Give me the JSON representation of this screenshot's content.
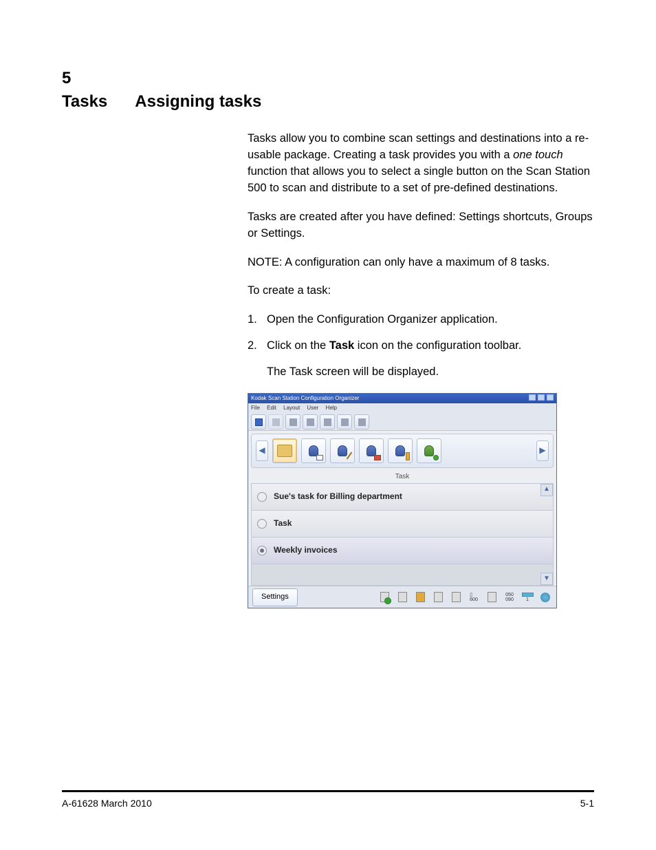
{
  "section": {
    "number": "5",
    "title_left": "Tasks",
    "title_right": "Assigning tasks"
  },
  "body": {
    "p1_a": "Tasks allow you to combine scan settings and destinations into a re-usable package. Creating a task provides you with a",
    "p1_em": "one touch",
    "p1_b": "function that allows you to select a single button on the Scan Station 500 to scan and distribute to a set of pre-defined destinations.",
    "p2": "Tasks are created after you have defined: Settings shortcuts, Groups or Settings.",
    "note_label": "NOTE:",
    "note_text": "A configuration can only have a maximum of 8 tasks.",
    "steps_heading": "To create a task:",
    "step1_num": "1.",
    "step1": "Open the Configuration Organizer application.",
    "step2_num": "2.",
    "step2_a": "Click on the",
    "step2_b": "Task",
    "step2_c": "icon on the configuration toolbar.",
    "sub_result": "The Task screen will be displayed."
  },
  "screenshot": {
    "title": "Kodak Scan Station Configuration Organizer",
    "menu": {
      "file": "File",
      "edit": "Edit",
      "layout": "Layout",
      "user": "User",
      "help": "Help"
    },
    "ribbon_label": "Task",
    "tasks": {
      "0": {
        "label": "Sue's task for Billing department"
      },
      "1": {
        "label": "Task"
      },
      "2": {
        "label": "Weekly invoices"
      }
    },
    "settings_button": "Settings",
    "footer_text": {
      "a": "600",
      "b": "050",
      "c": "090",
      "d": "1"
    }
  },
  "footer": {
    "left": "A-61628  March 2010",
    "right": "5-1"
  }
}
